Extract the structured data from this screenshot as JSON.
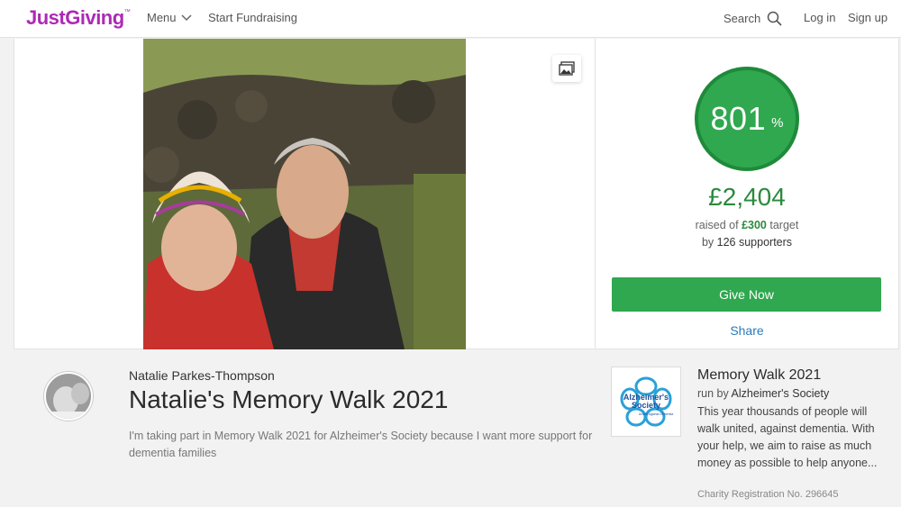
{
  "header": {
    "logo": "JustGiving",
    "logo_tm": "™",
    "menu_label": "Menu",
    "start_fundraising": "Start Fundraising",
    "search_label": "Search",
    "login": "Log in",
    "signup": "Sign up"
  },
  "donation": {
    "percent": "801",
    "percent_sign": "%",
    "raised": "£2,404",
    "raised_prefix": "raised of",
    "target": "£300",
    "target_suffix": "target",
    "supporters_prefix": "by",
    "supporters": "126 supporters",
    "give_now": "Give Now",
    "share": "Share"
  },
  "fundraiser": {
    "owner_name": "Natalie Parkes-Thompson",
    "title": "Natalie's Memory Walk 2021",
    "description": "I'm taking part in Memory Walk 2021 for Alzheimer's Society because I want more support for dementia families"
  },
  "charity": {
    "logo_line1": "Alzheimer's",
    "logo_line2": "Society",
    "logo_tagline": "United Against Dementia",
    "event_name": "Memory Walk 2021",
    "run_by_prefix": "run by",
    "charity_name": "Alzheimer's Society",
    "description": "This year thousands of people will walk united, against dementia. With your help, we aim to raise as much money as possible to help anyone...",
    "registration": "Charity Registration No. 296645"
  },
  "colors": {
    "brand": "#ad29b6",
    "green": "#2fa84f",
    "link": "#2c7ab8"
  }
}
